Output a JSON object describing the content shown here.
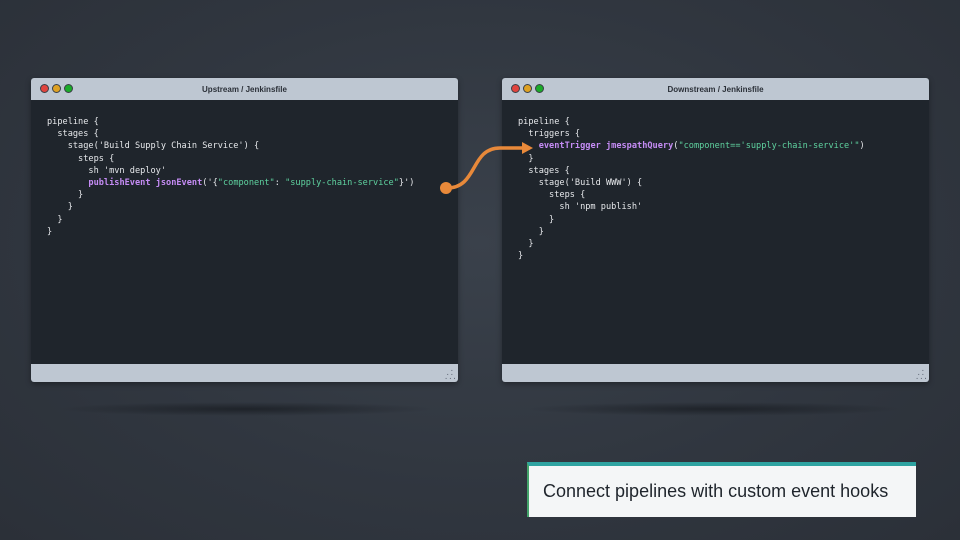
{
  "colors": {
    "background": "#30363f",
    "window_chrome": "#bec7d2",
    "editor_bg": "#1f252c",
    "keyword": "#c58cf5",
    "string": "#5fd3a0",
    "connector": "#e8893a",
    "caption_accent": "#2ea3a1"
  },
  "upstream": {
    "title": "Upstream / Jenkinsfile",
    "lines": [
      [
        {
          "t": "pipeline {",
          "c": "plain"
        }
      ],
      [
        {
          "t": "  stages {",
          "c": "plain"
        }
      ],
      [
        {
          "t": "    stage('Build Supply Chain Service') {",
          "c": "plain"
        }
      ],
      [
        {
          "t": "      steps {",
          "c": "plain"
        }
      ],
      [
        {
          "t": "        sh 'mvn deploy'",
          "c": "plain"
        }
      ],
      [
        {
          "t": "        ",
          "c": "plain"
        },
        {
          "t": "publishEvent",
          "c": "kw"
        },
        {
          "t": " ",
          "c": "plain"
        },
        {
          "t": "jsonEvent",
          "c": "kw"
        },
        {
          "t": "('{",
          "c": "plain"
        },
        {
          "t": "\"component\"",
          "c": "str"
        },
        {
          "t": ": ",
          "c": "plain"
        },
        {
          "t": "\"supply-chain-service\"",
          "c": "str"
        },
        {
          "t": "}')",
          "c": "plain"
        }
      ],
      [
        {
          "t": "      }",
          "c": "plain"
        }
      ],
      [
        {
          "t": "    }",
          "c": "plain"
        }
      ],
      [
        {
          "t": "  }",
          "c": "plain"
        }
      ],
      [
        {
          "t": "}",
          "c": "plain"
        }
      ]
    ]
  },
  "downstream": {
    "title": "Downstream / Jenkinsfile",
    "lines": [
      [
        {
          "t": "pipeline {",
          "c": "plain"
        }
      ],
      [
        {
          "t": "  triggers {",
          "c": "plain"
        }
      ],
      [
        {
          "t": "    ",
          "c": "plain"
        },
        {
          "t": "eventTrigger",
          "c": "kw"
        },
        {
          "t": " ",
          "c": "plain"
        },
        {
          "t": "jmespathQuery",
          "c": "kw"
        },
        {
          "t": "(",
          "c": "plain"
        },
        {
          "t": "\"component=='supply-chain-service'\"",
          "c": "str"
        },
        {
          "t": ")",
          "c": "plain"
        }
      ],
      [
        {
          "t": "  }",
          "c": "plain"
        }
      ],
      [
        {
          "t": "  stages {",
          "c": "plain"
        }
      ],
      [
        {
          "t": "    stage('Build WWW') {",
          "c": "plain"
        }
      ],
      [
        {
          "t": "      steps {",
          "c": "plain"
        }
      ],
      [
        {
          "t": "        sh 'npm publish'",
          "c": "plain"
        }
      ],
      [
        {
          "t": "      }",
          "c": "plain"
        }
      ],
      [
        {
          "t": "    }",
          "c": "plain"
        }
      ],
      [
        {
          "t": "  }",
          "c": "plain"
        }
      ],
      [
        {
          "t": "}",
          "c": "plain"
        }
      ]
    ]
  },
  "caption": {
    "text": "Connect pipelines with custom event hooks"
  }
}
